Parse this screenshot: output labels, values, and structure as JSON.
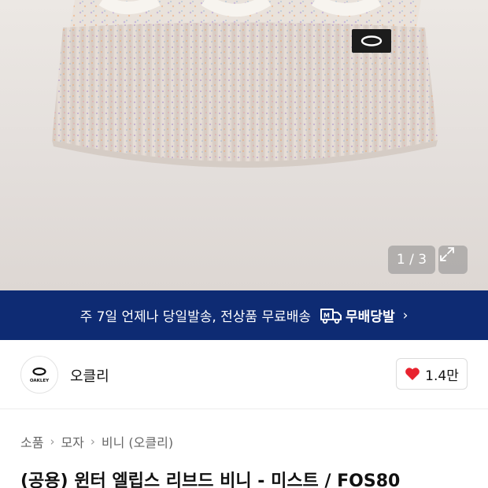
{
  "gallery": {
    "counter": "1 / 3",
    "expand_icon": "expand-icon"
  },
  "banner": {
    "text": "주 7일 언제나 당일발송, 전상품 무료배송",
    "service_label": "무배당발",
    "truck_icon": "delivery-truck-icon",
    "chevron": "›",
    "background": "#0e2b73"
  },
  "brand": {
    "name": "오클리",
    "logo_text": "OAKLEY",
    "like_count": "1.4만",
    "heart_color": "#e8232f"
  },
  "breadcrumb": {
    "items": [
      "소품",
      "모자",
      "비니 (오클리)"
    ],
    "separator": "›"
  },
  "product": {
    "title": "(공용) 윈터 엘립스 리브드 비니 - 미스트 / FOS80"
  }
}
